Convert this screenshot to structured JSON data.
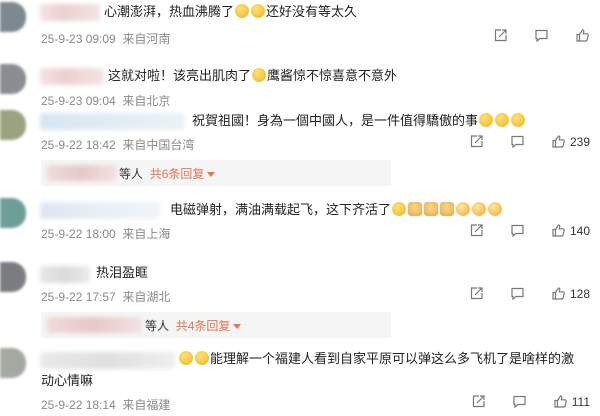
{
  "comments": [
    {
      "text": "心潮澎湃，热血沸腾了",
      "text_after": "还好没有等太久",
      "date": "25-9-23 09:09",
      "location": "来自河南",
      "likes": ""
    },
    {
      "text": "这就对啦！该亮出肌肉了",
      "text_after": "鹰酱惊不惊喜意不意外",
      "date": "25-9-23 09:04",
      "location": "来自北京",
      "likes": ""
    },
    {
      "text": "祝賀祖國！身為一個中國人，是一件值得驕傲的事",
      "date": "25-9-22 18:42",
      "location": "来自中国台湾",
      "likes": "239",
      "reply_suffix": "等人",
      "reply_link": "共6条回复"
    },
    {
      "text": "电磁弹射，满油满载起飞，这下齐活了",
      "date": "25-9-22 18:00",
      "location": "来自上海",
      "likes": "140"
    },
    {
      "text": "热泪盈眶",
      "date": "25-9-22 17:57",
      "location": "来自湖北",
      "likes": "128",
      "reply_suffix": "等人",
      "reply_link": "共4条回复"
    },
    {
      "text": "能理解一个福建人看到自家平原可以弹这么多飞机了是啥样的激",
      "text_line2": "动心情嘛",
      "date": "25-9-22 18:14",
      "location": "来自福建",
      "likes": "111"
    }
  ],
  "icons": {
    "share": "share-icon",
    "comment": "comment-icon",
    "like": "thumbs-up-icon"
  },
  "colors": {
    "reply_link": "#eb7350",
    "meta_text": "#8a8a8a",
    "reply_bg": "#f5f5f5"
  }
}
